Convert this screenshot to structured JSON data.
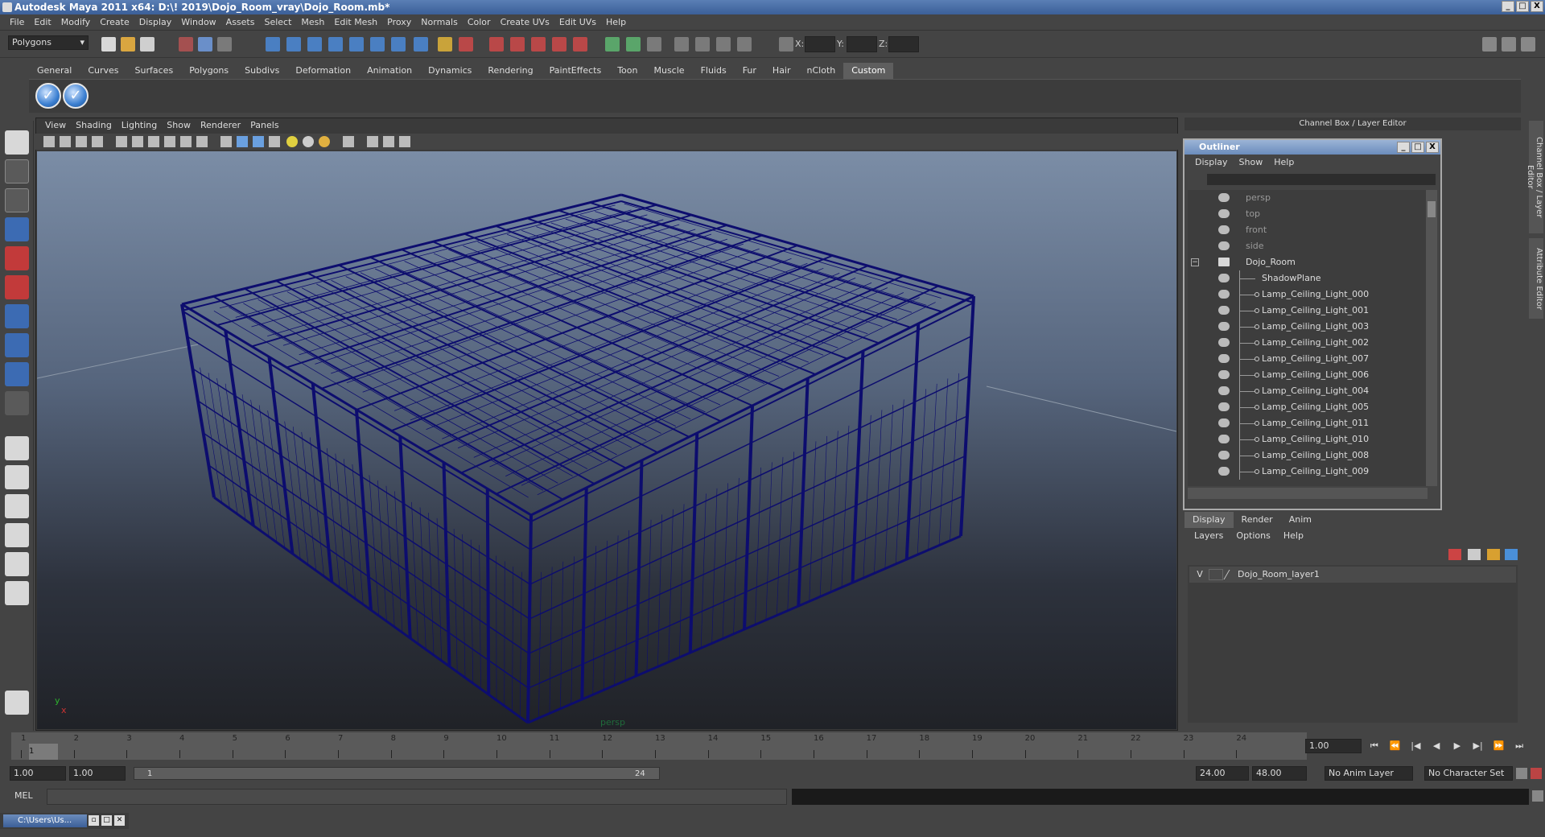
{
  "titlebar": {
    "title": "Autodesk Maya 2011 x64: D:\\! 2019\\Dojo_Room_vray\\Dojo_Room.mb*",
    "controls": [
      "_",
      "□",
      "X"
    ]
  },
  "menubar": [
    "File",
    "Edit",
    "Modify",
    "Create",
    "Display",
    "Window",
    "Assets",
    "Select",
    "Mesh",
    "Edit Mesh",
    "Proxy",
    "Normals",
    "Color",
    "Create UVs",
    "Edit UVs",
    "Help"
  ],
  "statusline": {
    "mode": "Polygons",
    "x_label": "X:",
    "y_label": "Y:",
    "z_label": "Z:"
  },
  "shelf": {
    "tabs": [
      "General",
      "Curves",
      "Surfaces",
      "Polygons",
      "Subdivs",
      "Deformation",
      "Animation",
      "Dynamics",
      "Rendering",
      "PaintEffects",
      "Toon",
      "Muscle",
      "Fluids",
      "Fur",
      "Hair",
      "nCloth",
      "Custom"
    ],
    "active_tab": "Custom",
    "buttons": [
      "check-icon",
      "check-icon"
    ]
  },
  "viewport": {
    "menu": [
      "View",
      "Shading",
      "Lighting",
      "Show",
      "Renderer",
      "Panels"
    ],
    "camera_label": "persp",
    "axis_y": "y",
    "axis_x": "x",
    "wire_color": "#0d0d6e"
  },
  "channel_box": {
    "header": "Channel Box / Layer Editor",
    "side_tabs": [
      "Channel Box / Layer Editor",
      "Attribute Editor"
    ]
  },
  "outliner": {
    "title": "Outliner",
    "menu": [
      "Display",
      "Show",
      "Help"
    ],
    "cameras": [
      "persp",
      "top",
      "front",
      "side"
    ],
    "group": "Dojo_Room",
    "children": [
      "ShadowPlane",
      "Lamp_Ceiling_Light_000",
      "Lamp_Ceiling_Light_001",
      "Lamp_Ceiling_Light_003",
      "Lamp_Ceiling_Light_002",
      "Lamp_Ceiling_Light_007",
      "Lamp_Ceiling_Light_006",
      "Lamp_Ceiling_Light_004",
      "Lamp_Ceiling_Light_005",
      "Lamp_Ceiling_Light_011",
      "Lamp_Ceiling_Light_010",
      "Lamp_Ceiling_Light_008",
      "Lamp_Ceiling_Light_009"
    ]
  },
  "layer_editor": {
    "tabs": [
      "Display",
      "Render",
      "Anim"
    ],
    "active_tab": "Display",
    "menu": [
      "Layers",
      "Options",
      "Help"
    ],
    "layer": {
      "visible": "V",
      "name": "Dojo_Room_layer1"
    }
  },
  "timeslider": {
    "ticks": [
      "1",
      "2",
      "3",
      "4",
      "5",
      "6",
      "7",
      "8",
      "9",
      "10",
      "11",
      "12",
      "13",
      "14",
      "15",
      "16",
      "17",
      "18",
      "19",
      "20",
      "21",
      "22",
      "23",
      "24"
    ],
    "current_frame_marker": "1",
    "current_frame": "1.00",
    "playback_buttons": [
      "⏮",
      "⏪",
      "|◀",
      "◀",
      "▶",
      "▶|",
      "⏩",
      "⏭"
    ]
  },
  "rangeslider": {
    "start": "1.00",
    "playback_start": "1.00",
    "bar_start": "1",
    "bar_end": "24",
    "playback_end": "24.00",
    "end": "48.00",
    "anim_layer": "No Anim Layer",
    "character_set": "No Character Set"
  },
  "cmdline": {
    "label": "MEL"
  },
  "taskbar": {
    "item": "C:\\Users\\Us..."
  }
}
